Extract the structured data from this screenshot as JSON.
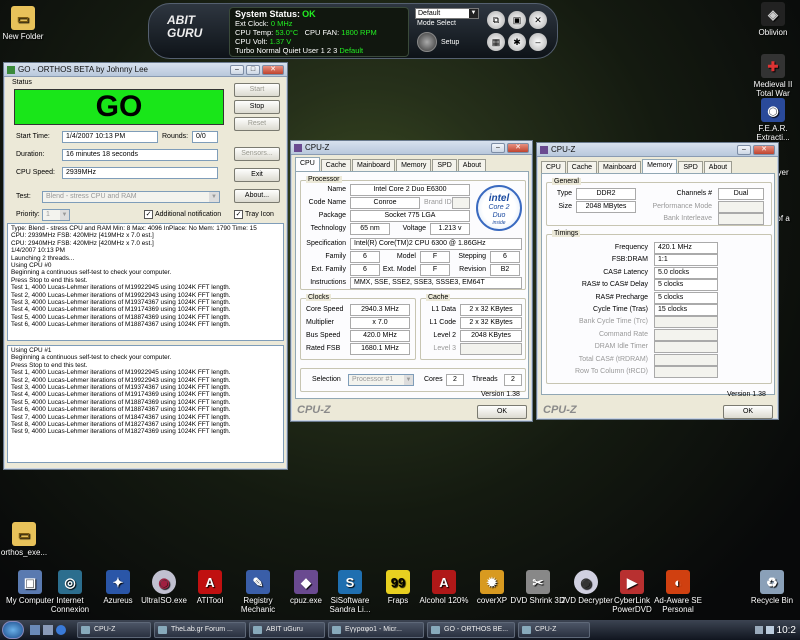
{
  "desktop": {
    "left_icons": [
      {
        "label": "New Folder"
      },
      {
        "label": "orthos_exe..."
      }
    ],
    "right_icons": [
      {
        "label": "Oblivion"
      },
      {
        "label": "Medieval II Total War"
      },
      {
        "label": "F.E.A.R. Extracti..."
      },
      {
        "label": "layer"
      },
      {
        "label": "s of a"
      }
    ],
    "bottom_icons": [
      {
        "label": "My Computer"
      },
      {
        "label": "Internet Connexion"
      },
      {
        "label": "Azureus"
      },
      {
        "label": "UltraISO.exe"
      },
      {
        "label": "ATITool"
      },
      {
        "label": "Registry Mechanic"
      },
      {
        "label": "cpuz.exe"
      },
      {
        "label": "SiSoftware Sandra Li..."
      },
      {
        "label": "Fraps"
      },
      {
        "label": "Alcohol 120%"
      },
      {
        "label": "coverXP"
      },
      {
        "label": "DVD Shrink 3.2"
      },
      {
        "label": "DVD Decrypter"
      },
      {
        "label": "CyberLink PowerDVD"
      },
      {
        "label": "Ad-Aware SE Personal"
      },
      {
        "label": "Recycle Bin"
      }
    ]
  },
  "guru": {
    "logo": "ABIT GURU",
    "status_label": "System Status:",
    "status_value": "OK",
    "ext_clock_label": "Ext Clock:",
    "ext_clock_value": "0 MHz",
    "cpu_temp_label": "CPU Temp:",
    "cpu_temp_value": "53.0°C",
    "cpu_fan_label": "CPU FAN:",
    "cpu_fan_value": "1800 RPM",
    "cpu_volt_label": "CPU Volt:",
    "cpu_volt_value": "1.37 V",
    "modes": "Turbo  Normal  Quiet  User  1  2  3",
    "mode_default": "Default",
    "dropdown": "Default",
    "mode_select": "Mode Select",
    "setup": "Setup"
  },
  "orthos": {
    "title": "GO - ORTHOS BETA by Johnny Lee",
    "status_group": "Status",
    "status_text": "GO",
    "start_btn": "Start",
    "stop_btn": "Stop",
    "reset_btn": "Reset",
    "start_time_label": "Start Time:",
    "start_time": "1/4/2007 10:13 PM",
    "rounds_label": "Rounds:",
    "rounds": "0/0",
    "duration_label": "Duration:",
    "duration": "16 minutes 18 seconds",
    "sensors_btn": "Sensors...",
    "cpu_speed_label": "CPU Speed:",
    "cpu_speed": "2939MHz",
    "exit_btn": "Exit",
    "test_label": "Test:",
    "test_value": "Blend - stress CPU and RAM",
    "about_btn": "About...",
    "priority_label": "Priority:",
    "priority_value": "1",
    "additional_notification": "Additional notification",
    "tray_icon": "Tray Icon",
    "log1": [
      "Type: Blend - stress CPU and RAM Min: 8 Max: 4096 InPlace: No Mem: 1790 Time: 15",
      "CPU: 2939MHz FSB: 420MHz [419MHz x 7.0 est.]",
      "CPU: 2940MHz FSB: 420MHz [420MHz x 7.0 est.]",
      "1/4/2007 10:13 PM",
      "Launching 2 threads...",
      "Using CPU #0",
      "Beginning a continuous self-test to check your computer.",
      "Press Stop to end this test.",
      "Test 1, 4000 Lucas-Lehmer iterations of M19922945 using 1024K FFT length.",
      "Test 2, 4000 Lucas-Lehmer iterations of M19922943 using 1024K FFT length.",
      "Test 3, 4000 Lucas-Lehmer iterations of M19374367 using 1024K FFT length.",
      "Test 4, 4000 Lucas-Lehmer iterations of M19174369 using 1024K FFT length.",
      "Test 5, 4000 Lucas-Lehmer iterations of M18874369 using 1024K FFT length.",
      "Test 6, 4000 Lucas-Lehmer iterations of M18874367 using 1024K FFT length."
    ],
    "log2": [
      "Using CPU #1",
      "Beginning a continuous self-test to check your computer.",
      "Press Stop to end this test.",
      "Test 1, 4000 Lucas-Lehmer iterations of M19922945 using 1024K FFT length.",
      "Test 2, 4000 Lucas-Lehmer iterations of M19922943 using 1024K FFT length.",
      "Test 3, 4000 Lucas-Lehmer iterations of M19374367 using 1024K FFT length.",
      "Test 4, 4000 Lucas-Lehmer iterations of M19174369 using 1024K FFT length.",
      "Test 5, 4000 Lucas-Lehmer iterations of M18874369 using 1024K FFT length.",
      "Test 6, 4000 Lucas-Lehmer iterations of M18874367 using 1024K FFT length.",
      "Test 7, 4000 Lucas-Lehmer iterations of M18474367 using 1024K FFT length.",
      "Test 8, 4000 Lucas-Lehmer iterations of M18274367 using 1024K FFT length.",
      "Test 9, 4000 Lucas-Lehmer iterations of M18274369 using 1024K FFT length."
    ]
  },
  "cpuz1": {
    "title": "CPU-Z",
    "tabs": [
      "CPU",
      "Cache",
      "Mainboard",
      "Memory",
      "SPD",
      "About"
    ],
    "processor_group": "Processor",
    "name_label": "Name",
    "name": "Intel Core 2 Duo E6300",
    "codename_label": "Code Name",
    "codename": "Conroe",
    "brand_id_label": "Brand ID",
    "package_label": "Package",
    "package": "Socket 775 LGA",
    "technology_label": "Technology",
    "technology": "65 nm",
    "voltage_label": "Voltage",
    "voltage": "1.213 v",
    "spec_label": "Specification",
    "spec": "Intel(R) Core(TM)2 CPU        6300  @ 1.86GHz",
    "family_label": "Family",
    "family": "6",
    "model_label": "Model",
    "model": "F",
    "stepping_label": "Stepping",
    "stepping": "6",
    "ext_family_label": "Ext. Family",
    "ext_family": "6",
    "ext_model_label": "Ext. Model",
    "ext_model": "F",
    "revision_label": "Revision",
    "revision": "B2",
    "instr_label": "Instructions",
    "instr": "MMX, SSE, SSE2, SSE3, SSSE3, EM64T",
    "logo_brand": "intel",
    "logo_line1": "Core 2",
    "logo_line2": "Duo",
    "logo_inside": "inside",
    "clocks_group": "Clocks",
    "core_speed_label": "Core Speed",
    "core_speed": "2940.3 MHz",
    "multiplier_label": "Multiplier",
    "multiplier": "x 7.0",
    "bus_speed_label": "Bus Speed",
    "bus_speed": "420.0 MHz",
    "rated_fsb_label": "Rated FSB",
    "rated_fsb": "1680.1 MHz",
    "cache_group": "Cache",
    "l1d_label": "L1 Data",
    "l1d": "2 x 32 KBytes",
    "l1c_label": "L1 Code",
    "l1c": "2 x 32 KBytes",
    "l2_label": "Level 2",
    "l2": "2048 KBytes",
    "l3_label": "Level 3",
    "selection_label": "Selection",
    "selection": "Processor #1",
    "cores_label": "Cores",
    "cores": "2",
    "threads_label": "Threads",
    "threads": "2",
    "version": "Version 1.38",
    "ok": "OK",
    "brand": "CPU-Z"
  },
  "cpuz2": {
    "title": "CPU-Z",
    "tabs": [
      "CPU",
      "Cache",
      "Mainboard",
      "Memory",
      "SPD",
      "About"
    ],
    "general_group": "General",
    "type_label": "Type",
    "type": "DDR2",
    "channels_label": "Channels #",
    "channels": "Dual",
    "size_label": "Size",
    "size": "2048 MBytes",
    "perf_mode_label": "Performance Mode",
    "bank_label": "Bank Interleave",
    "timings_group": "Timings",
    "t_labels": [
      "Frequency",
      "FSB:DRAM",
      "CAS# Latency",
      "RAS# to CAS# Delay",
      "RAS# Precharge",
      "Cycle Time (Tras)",
      "Bank Cycle Time (Trc)",
      "Command Rate",
      "DRAM Idle Timer",
      "Total CAS# (tRDRAM)",
      "Row To Column (tRCD)"
    ],
    "t_values": [
      "420.1 MHz",
      "1:1",
      "5.0 clocks",
      "5 clocks",
      "5 clocks",
      "15 clocks"
    ],
    "version": "Version 1.38",
    "ok": "OK",
    "brand": "CPU-Z"
  },
  "taskbar": {
    "items": [
      "CPU-Z",
      "TheLab.gr Forum ...",
      "ABIT uGuru",
      "Εγγραφο1 - Micr...",
      "GO - ORTHOS BE...",
      "CPU-Z"
    ],
    "clock": "10:2"
  }
}
